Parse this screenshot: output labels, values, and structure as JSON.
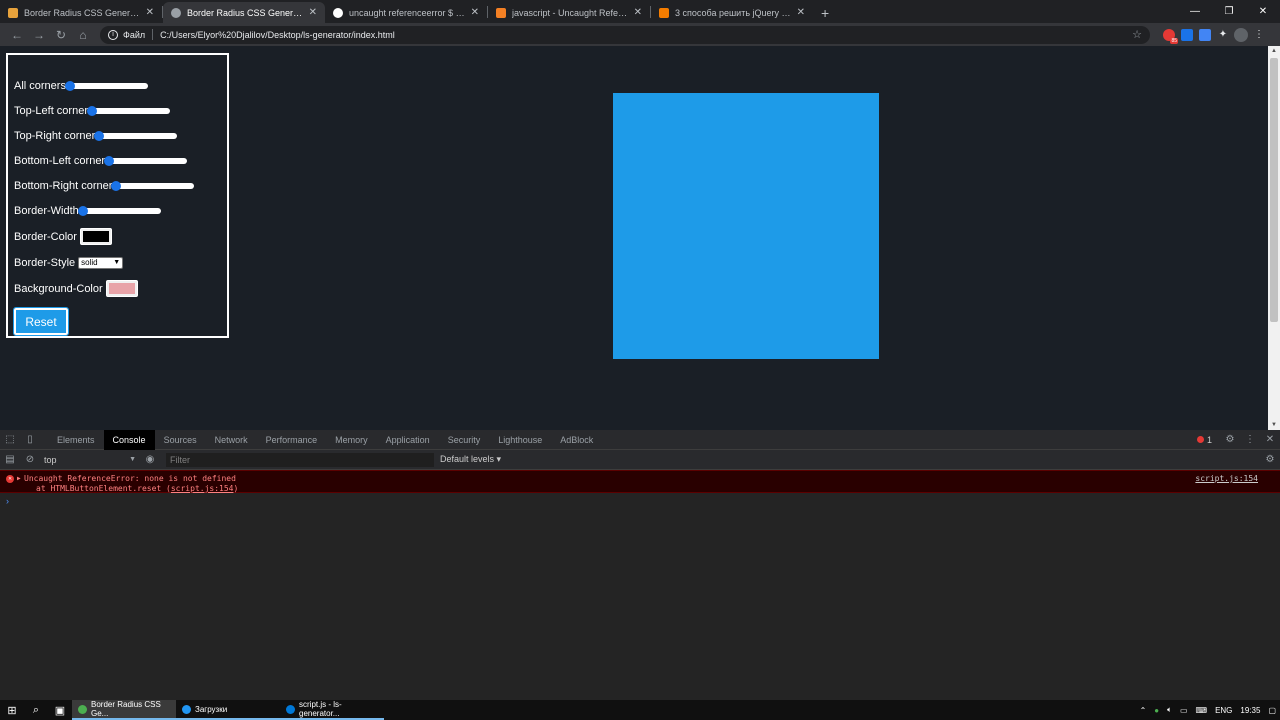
{
  "browser": {
    "tabs": [
      {
        "title": "Border Radius CSS Generator",
        "favicon_color": "#e8a33c",
        "active": false
      },
      {
        "title": "Border Radius CSS Generator",
        "favicon_color": "#9aa0a6",
        "active": true
      },
      {
        "title": "uncaught referenceerror $ is not",
        "favicon_color": "#ffffff",
        "active": false
      },
      {
        "title": "javascript - Uncaught Reference",
        "favicon_color": "#f48024",
        "active": false
      },
      {
        "title": "3 способа решить jQuery - Unca",
        "favicon_color": "#f57d00",
        "active": false
      }
    ],
    "new_tab": "+",
    "address": {
      "scheme_label": "Файл",
      "url": "C:/Users/Elyor%20Djalilov/Desktop/ls-generator/index.html"
    },
    "extension_badge": "85"
  },
  "panel": {
    "ranges": [
      {
        "label": "All corners"
      },
      {
        "label": "Top-Left corner"
      },
      {
        "label": "Top-Right corner"
      },
      {
        "label": "Bottom-Left corner"
      },
      {
        "label": "Bottom-Right corner"
      },
      {
        "label": "Border-Width"
      }
    ],
    "border_color_label": "Border-Color",
    "border_color_value": "#000000",
    "border_style_label": "Border-Style",
    "border_style_value": "solid",
    "background_color_label": "Background-Color",
    "background_color_value": "#e8a3a8",
    "reset_label": "Reset"
  },
  "preview_box": {
    "color": "#1e9be8"
  },
  "devtools": {
    "tabs": [
      "Elements",
      "Console",
      "Sources",
      "Network",
      "Performance",
      "Memory",
      "Application",
      "Security",
      "Lighthouse",
      "AdBlock"
    ],
    "active_tab": "Console",
    "error_count": "1",
    "context": "top",
    "filter_placeholder": "Filter",
    "levels": "Default levels",
    "error": {
      "message": "Uncaught ReferenceError: none is not defined",
      "stack_prefix": "at HTMLButtonElement.reset (",
      "stack_link": "script.js:154",
      "stack_suffix": ")",
      "source": "script.js:154"
    },
    "prompt": "›"
  },
  "taskbar": {
    "apps": [
      {
        "label": "Border Radius CSS Ge...",
        "icon_color": "#4caf50",
        "active": true
      },
      {
        "label": "Загрузки",
        "icon_color": "#2196f3",
        "active": false
      },
      {
        "label": "script.js - ls-generator...",
        "icon_color": "#0078d7",
        "active": false
      }
    ],
    "lang": "ENG",
    "time": "19:35"
  }
}
